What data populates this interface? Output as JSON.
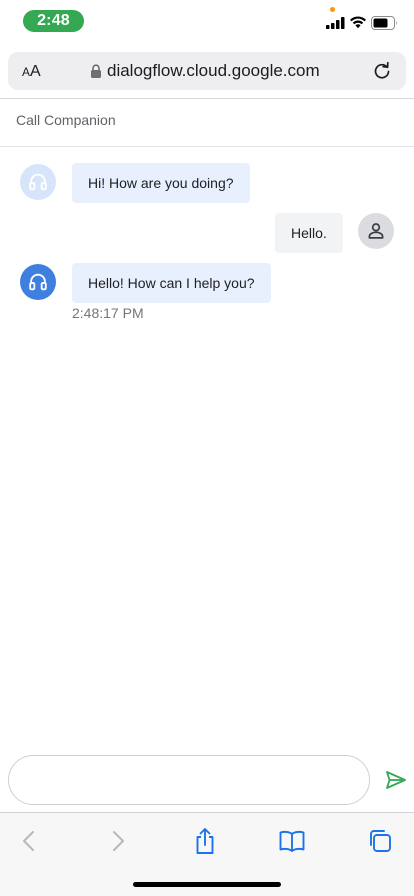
{
  "status_bar": {
    "time": "2:48"
  },
  "address_bar": {
    "aa_small": "A",
    "aa_large": "A",
    "url": "dialogflow.cloud.google.com"
  },
  "chat": {
    "title": "Call Companion",
    "messages": [
      {
        "sender": "bot",
        "text": "Hi! How are you doing?"
      },
      {
        "sender": "user",
        "text": "Hello."
      },
      {
        "sender": "bot",
        "text": "Hello! How can I help you?",
        "timestamp": "2:48:17 PM"
      }
    ]
  },
  "input": {
    "value": "",
    "placeholder": ""
  },
  "colors": {
    "accent": "#34a853",
    "bot_avatar": "#3f7fe0",
    "bot_bubble": "#e8f0fe",
    "safari_blue": "#1a73e8"
  },
  "icons": [
    "signal-icon",
    "wifi-icon",
    "battery-icon",
    "lock-icon",
    "reload-icon",
    "headset-icon",
    "person-icon",
    "send-icon",
    "back-icon",
    "forward-icon",
    "share-icon",
    "bookmarks-icon",
    "tabs-icon"
  ]
}
